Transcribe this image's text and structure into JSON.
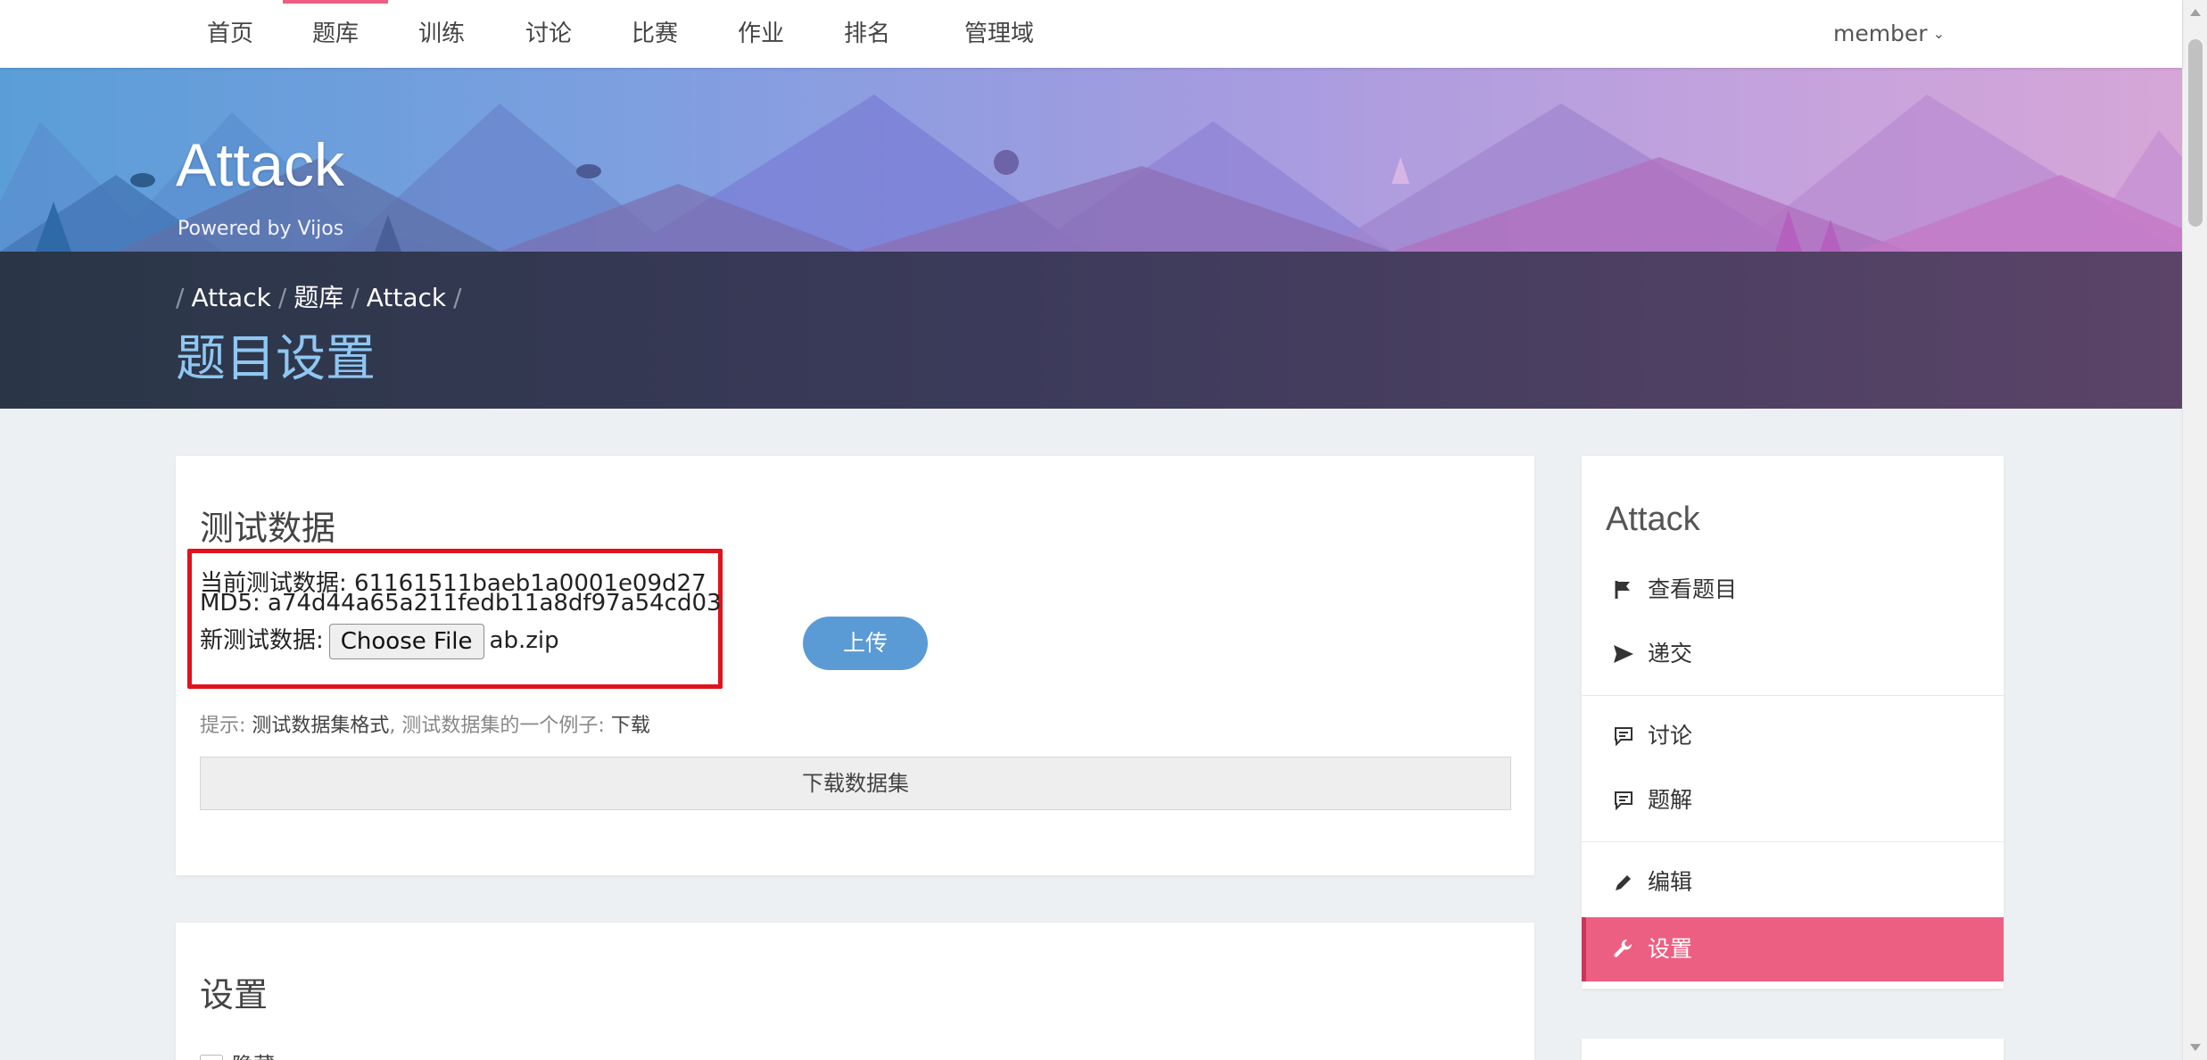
{
  "nav": {
    "items": [
      {
        "label": "首页"
      },
      {
        "label": "题库"
      },
      {
        "label": "训练"
      },
      {
        "label": "讨论"
      },
      {
        "label": "比赛"
      },
      {
        "label": "作业"
      },
      {
        "label": "排名"
      },
      {
        "label": "管理域"
      }
    ],
    "active_index": 1,
    "user": "member"
  },
  "hero": {
    "title": "Attack",
    "subtitle": "Powered by Vijos"
  },
  "breadcrumb": [
    "Attack",
    "题库",
    "Attack"
  ],
  "page_title": "题目设置",
  "testdata": {
    "title": "测试数据",
    "current_label": "当前测试数据: 61161511baeb1a0001e09d27",
    "md5_label": "MD5: a74d44a65a211fedb11a8df97a54cd03",
    "new_label": "新测试数据:",
    "choose_file": "Choose File",
    "file_name": "ab.zip",
    "upload": "上传",
    "hint_prefix": "提示: ",
    "hint_link1": "测试数据集格式",
    "hint_mid": ", 测试数据集的一个例子: ",
    "hint_link2": "下载",
    "download_set": "下载数据集"
  },
  "settings": {
    "title": "设置",
    "hidden_label": "隐藏"
  },
  "sidebar": {
    "title": "Attack",
    "items": [
      {
        "label": "查看题目",
        "icon": "flag-icon"
      },
      {
        "label": "递交",
        "icon": "send-icon"
      },
      {
        "label": "讨论",
        "icon": "comment-icon"
      },
      {
        "label": "题解",
        "icon": "comment-icon"
      },
      {
        "label": "编辑",
        "icon": "pencil-icon"
      },
      {
        "label": "设置",
        "icon": "wrench-icon"
      }
    ],
    "active_index": 5
  },
  "colors": {
    "accent": "#ed5f82",
    "highlight_box": "#e0121c",
    "upload_button": "#5b9bd5",
    "page_title": "#8fc7f2"
  }
}
